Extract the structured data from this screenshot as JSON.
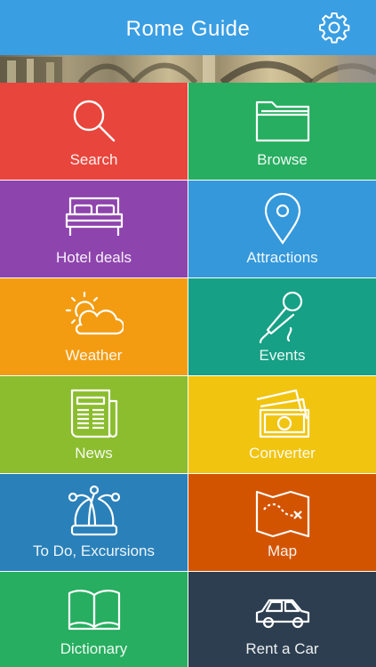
{
  "header": {
    "title": "Rome Guide",
    "background": "#3a9ee3",
    "settings_icon": "gear-icon"
  },
  "tiles": [
    {
      "label": "Search",
      "icon": "search-icon",
      "color": "#e8453c"
    },
    {
      "label": "Browse",
      "icon": "folder-icon",
      "color": "#27ae60"
    },
    {
      "label": "Hotel deals",
      "icon": "bed-icon",
      "color": "#8e44ad"
    },
    {
      "label": "Attractions",
      "icon": "map-pin-icon",
      "color": "#3498db"
    },
    {
      "label": "Weather",
      "icon": "sun-cloud-icon",
      "color": "#f39c12"
    },
    {
      "label": "Events",
      "icon": "microphone-icon",
      "color": "#16a085"
    },
    {
      "label": "News",
      "icon": "newspaper-icon",
      "color": "#8bbd2e"
    },
    {
      "label": "Converter",
      "icon": "money-icon",
      "color": "#f1c40f"
    },
    {
      "label": "To Do, Excursions",
      "icon": "jester-hat-icon",
      "color": "#2a80b9"
    },
    {
      "label": "Map",
      "icon": "treasure-map-icon",
      "color": "#d35400"
    },
    {
      "label": "Dictionary",
      "icon": "book-icon",
      "color": "#27ae60"
    },
    {
      "label": "Rent a Car",
      "icon": "car-icon",
      "color": "#2c3e50"
    }
  ]
}
